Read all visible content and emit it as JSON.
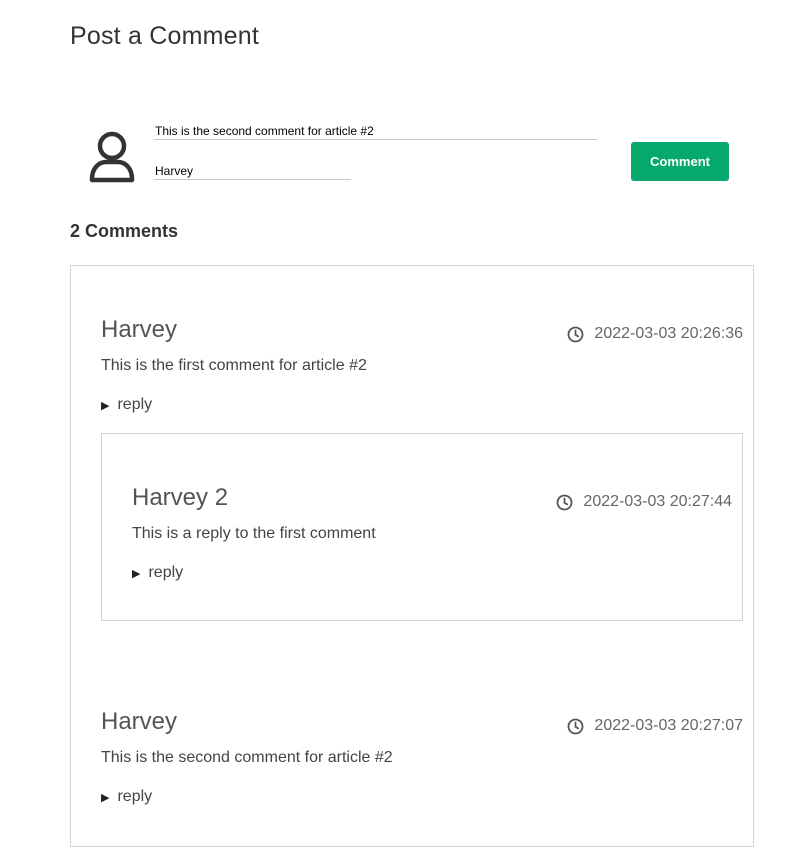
{
  "post": {
    "title": "Post a Comment",
    "comment_value": "This is the second comment for article #2",
    "name_value": "Harvey",
    "submit_label": "Comment"
  },
  "comments_heading": "2 Comments",
  "comments": [
    {
      "author": "Harvey",
      "timestamp": "2022-03-03 20:26:36",
      "body": "This is the first comment for article #2",
      "reply_label": "reply",
      "replies": [
        {
          "author": "Harvey 2",
          "timestamp": "2022-03-03 20:27:44",
          "body": "This is a reply to the first comment",
          "reply_label": "reply"
        }
      ]
    },
    {
      "author": "Harvey",
      "timestamp": "2022-03-03 20:27:07",
      "body": "This is the second comment for article #2",
      "reply_label": "reply",
      "replies": []
    }
  ],
  "icons": {
    "avatar": "user-outline-icon",
    "timestamp": "clock-icon",
    "reply": "triangle-right-icon"
  },
  "colors": {
    "accent": "#05a96b",
    "border": "#d2d2d2",
    "text": "#333333"
  }
}
